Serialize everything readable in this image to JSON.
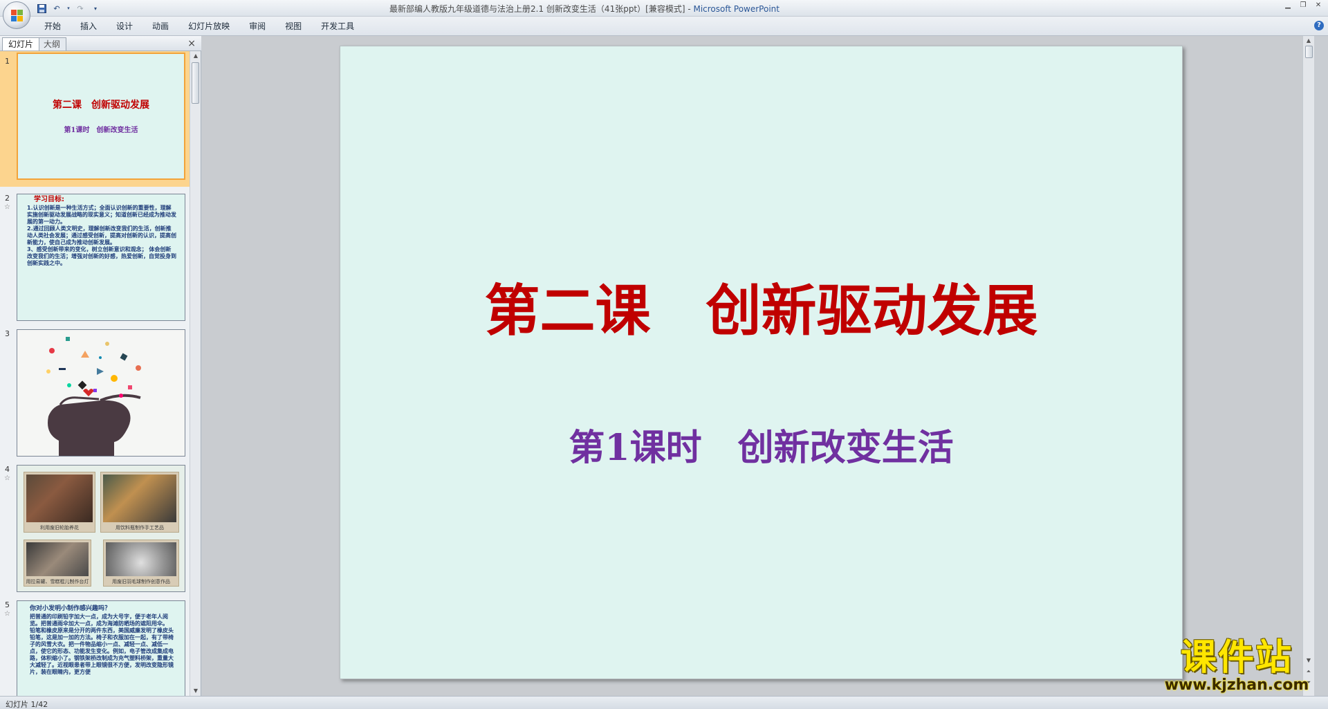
{
  "window": {
    "title": "最新部编人教版九年级道德与法治上册2.1 创新改变生活（41张ppt）[兼容模式] - ",
    "app_name": "Microsoft PowerPoint"
  },
  "ribbon": {
    "tabs": [
      "开始",
      "插入",
      "设计",
      "动画",
      "幻灯片放映",
      "审阅",
      "视图",
      "开发工具"
    ]
  },
  "left_pane": {
    "tabs": {
      "slides": "幻灯片",
      "outline": "大纲"
    },
    "close": "×",
    "thumbnails": [
      {
        "number": "1",
        "title": "第二课　创新驱动发展",
        "subtitle": "第1课时　创新改变生活"
      },
      {
        "number": "2",
        "star": "☆",
        "heading": "学习目标:",
        "lines": [
          "1.认识创新是一种生活方式；全面认识创新的重要性，理解实施创新驱动发展战略的现实意义；知道创新已经成为推动发展的第一动力。",
          "2.通过回顾人类文明史，理解创新改变我们的生活，创新推动人类社会发展；通过感受创新，提高对创新的认识，提高创新能力，使自己成为推动创新发展。",
          "3、感受创新带来的变化，树立创新意识和观念；  体会创新改变我们的生活；增强对创新的好感，热爱创新，自觉投身到创新实践之中。"
        ]
      },
      {
        "number": "3"
      },
      {
        "number": "4",
        "star": "☆",
        "captions": [
          "利用废旧轮胎养花",
          "用饮料瓶制作手工艺品",
          "用拉易罐、雪糕棍儿制作台灯",
          "用废旧羽毛球制作创意作品"
        ]
      },
      {
        "number": "5",
        "star": "☆",
        "heading": "你对小发明小制作感兴趣吗？",
        "lines": [
          "把普通的印刷铅字加大一点，成为大号字，便于老年人阅览。把普通雨伞加大一点，成为海滩防晒场的遮阳用伞。",
          "铅笔和橡皮原来是分开的两件东西，美国威廉发明了橡皮头铅笔，这是加一加的方法。椅子和衣服加在一起，有了带椅子的风雪大衣。把一件物品缩小一点、减轻一点、减低一点，使它的形态、功能发生变化。例如，电子管改成集成电路，体积缩小了。钢铁架桥改制成为充气塑料桥架，重量大大减轻了。近视眼患者带上眼镜很不方便，发明改变隐形镜片，装在眼睛内，更方便"
        ]
      }
    ]
  },
  "slide": {
    "title": "第二课　创新驱动发展",
    "subtitle": "第1课时　创新改变生活"
  },
  "watermark": {
    "cn": "课件站",
    "url": "www.kjzhan.com"
  },
  "status": {
    "slide_counter": "幻灯片 1/42"
  },
  "colors": {
    "slide_bg": "#dff4f0",
    "title_red": "#c00000",
    "subtitle_purple": "#7030a0",
    "selection": "#f2a33a"
  }
}
